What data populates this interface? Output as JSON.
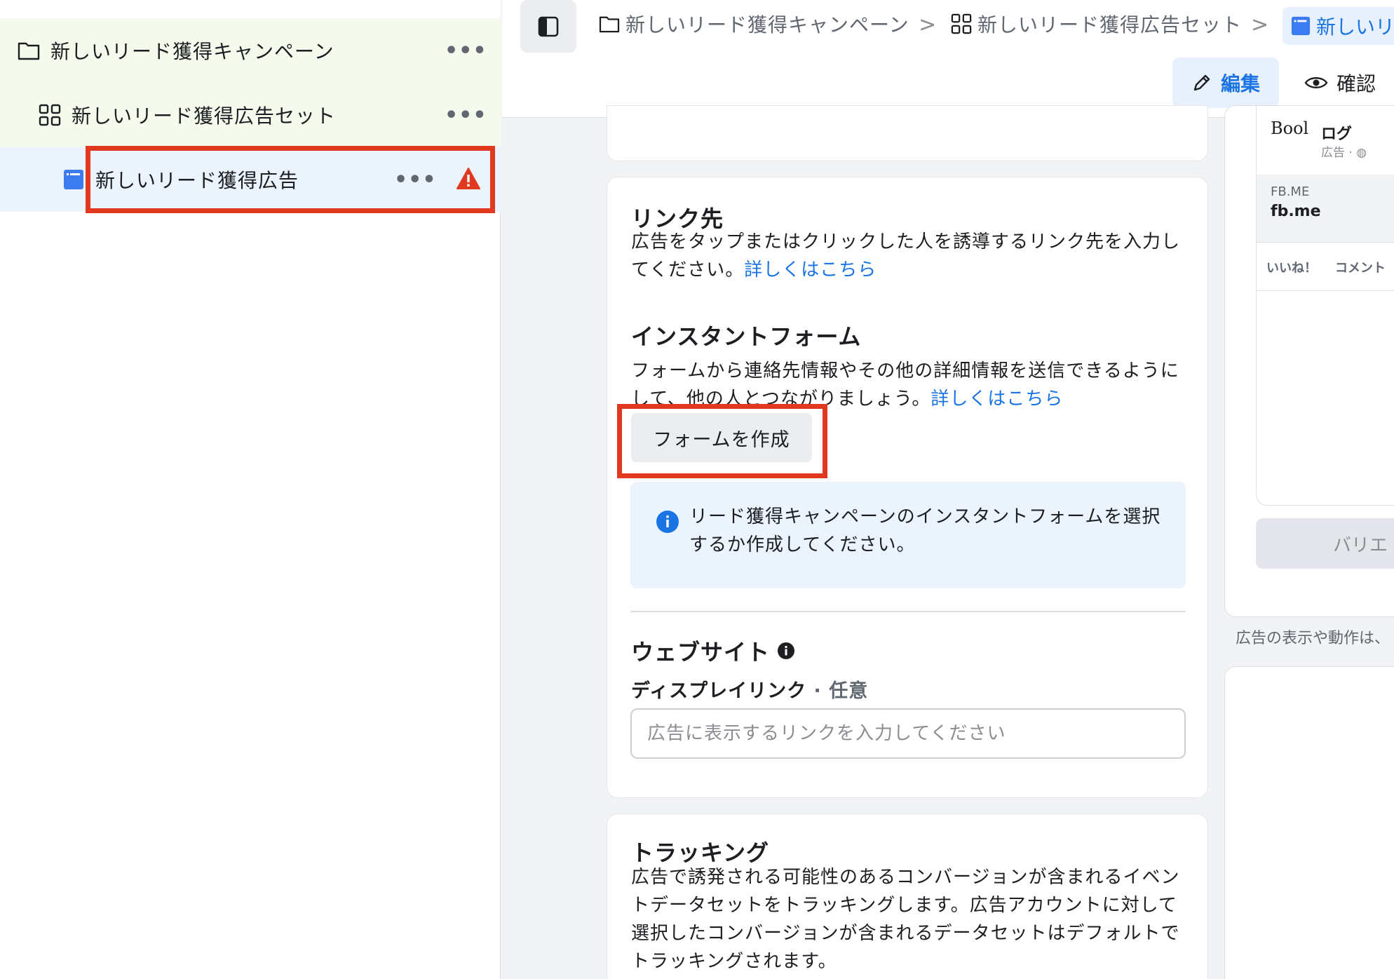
{
  "sidebar": {
    "campaign": {
      "label": "新しいリード獲得キャンペーン",
      "more": "•••"
    },
    "adset": {
      "label": "新しいリード獲得広告セット",
      "more": "•••"
    },
    "ad": {
      "label": "新しいリード獲得広告",
      "more": "•••"
    }
  },
  "breadcrumb": {
    "campaign": "新しいリード獲得キャンペーン",
    "adset": "新しいリード獲得広告セット",
    "ad": "新しいリ",
    "separator": ">"
  },
  "toolbar": {
    "edit_label": "編集",
    "preview_label": "確認"
  },
  "destination": {
    "title": "リンク先",
    "description": "広告をタップまたはクリックした人を誘導するリンク先を入力してください。",
    "learn_more": "詳しくはこちら"
  },
  "instant_form": {
    "title": "インスタントフォーム",
    "description": "フォームから連絡先情報やその他の詳細情報を送信できるようにして、他の人とつながりましょう。",
    "learn_more": "詳しくはこちら",
    "create_button": "フォームを作成",
    "info_message": "リード獲得キャンペーンのインスタントフォームを選択するか作成してください。"
  },
  "website": {
    "title": "ウェブサイト",
    "display_link_label": "ディスプレイリンク",
    "optional": "· 任意",
    "input_value": "",
    "input_placeholder": "広告に表示するリンクを入力してください"
  },
  "tracking": {
    "title": "トラッキング",
    "description": "広告で誘発される可能性のあるコンバージョンが含まれるイベントデータセットをトラッキングします。広告アカウントに対して選択したコンバージョンが含まれるデータセットはデフォルトでトラッキングされます。"
  },
  "preview": {
    "logo_text": "Bool",
    "page_name": "ログ",
    "ad_meta": "広告 · ◍",
    "link_domain": "FB.ME",
    "link_title": "fb.me",
    "like": "いいね！",
    "comment": "コメント",
    "variation_button": "バリエ",
    "note": "広告の表示や動作は、"
  },
  "colors": {
    "accent": "#1b74e4",
    "highlight": "#e0391f",
    "warning": "#e0391f"
  }
}
